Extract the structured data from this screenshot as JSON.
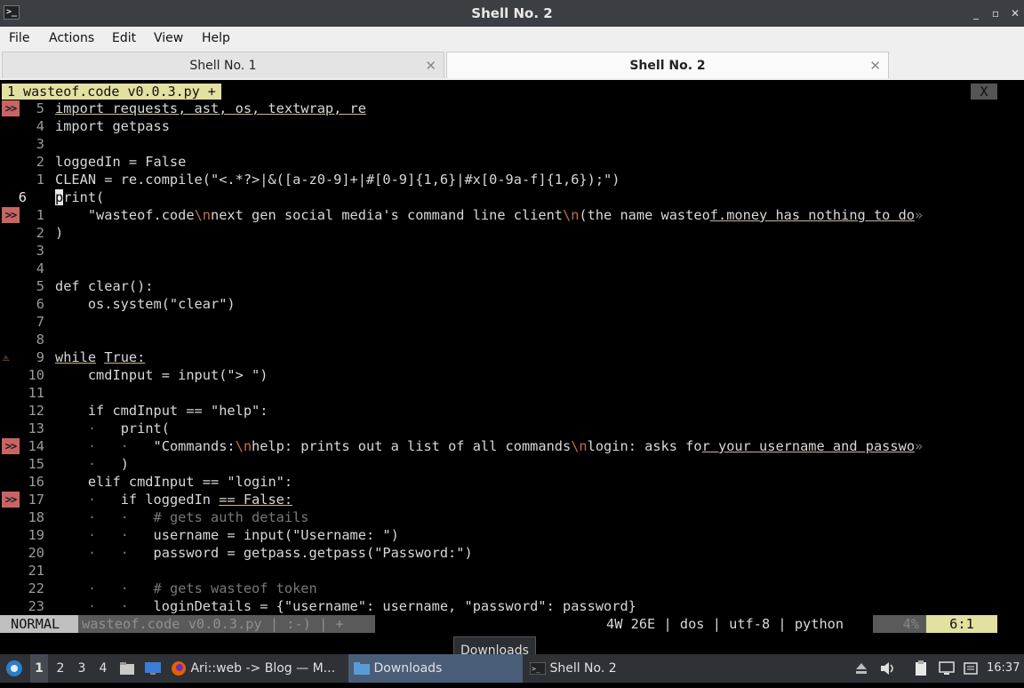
{
  "window": {
    "title": "Shell No. 2"
  },
  "menu": [
    "File",
    "Actions",
    "Edit",
    "View",
    "Help"
  ],
  "tabs": [
    {
      "label": "Shell No. 1"
    },
    {
      "label": "Shell No. 2"
    }
  ],
  "buffer": {
    "tab_label": "1 wasteof.code v0.0.3.py +",
    "close_label": "X"
  },
  "code_lines": [
    {
      "sign": ">>",
      "num": "5",
      "cur": false,
      "segs": [
        {
          "t": "import requests, ast, os, textwrap, re",
          "c": "ul"
        }
      ]
    },
    {
      "sign": "",
      "num": "4",
      "cur": false,
      "segs": [
        {
          "t": "import getpass"
        }
      ]
    },
    {
      "sign": "",
      "num": "3",
      "cur": false,
      "segs": []
    },
    {
      "sign": "",
      "num": "2",
      "cur": false,
      "segs": [
        {
          "t": "loggedIn = False"
        }
      ]
    },
    {
      "sign": "",
      "num": "1",
      "cur": false,
      "segs": [
        {
          "t": "CLEAN = re.compile(\"<.*?>|&([a-z0-9]+|#[0-9]{1,6}|#x[0-9a-f]{1,6});\")"
        }
      ]
    },
    {
      "sign": "",
      "num": "6",
      "cur": true,
      "segs": [
        {
          "t": "p",
          "c": "cursor"
        },
        {
          "t": "rint("
        }
      ]
    },
    {
      "sign": ">>",
      "num": "1",
      "cur": false,
      "segs": [
        {
          "t": "    \"wasteof.code"
        },
        {
          "t": "\\n",
          "c": "esc"
        },
        {
          "t": "next gen social media's command line client"
        },
        {
          "t": "\\n",
          "c": "esc"
        },
        {
          "t": "(the name wasteo"
        },
        {
          "t": "f.money has nothing to do",
          "c": "ul"
        },
        {
          "t": "»",
          "c": "dim"
        }
      ]
    },
    {
      "sign": "",
      "num": "2",
      "cur": false,
      "segs": [
        {
          "t": ")"
        }
      ]
    },
    {
      "sign": "",
      "num": "3",
      "cur": false,
      "segs": []
    },
    {
      "sign": "",
      "num": "4",
      "cur": false,
      "segs": []
    },
    {
      "sign": "",
      "num": "5",
      "cur": false,
      "segs": [
        {
          "t": "def clear():"
        }
      ]
    },
    {
      "sign": "",
      "num": "6",
      "cur": false,
      "segs": [
        {
          "t": "    os.system(\"clear\")"
        }
      ]
    },
    {
      "sign": "",
      "num": "7",
      "cur": false,
      "segs": []
    },
    {
      "sign": "",
      "num": "8",
      "cur": false,
      "segs": []
    },
    {
      "sign": "warn",
      "num": "9",
      "cur": false,
      "segs": [
        {
          "t": "while",
          "c": "ul"
        },
        {
          "t": " "
        },
        {
          "t": "True:",
          "c": "ul"
        }
      ]
    },
    {
      "sign": "",
      "num": "10",
      "cur": false,
      "segs": [
        {
          "t": "    cmdInput = input(\"> \")"
        }
      ]
    },
    {
      "sign": "",
      "num": "11",
      "cur": false,
      "segs": []
    },
    {
      "sign": "",
      "num": "12",
      "cur": false,
      "segs": [
        {
          "t": "    if cmdInput == \"help\":"
        }
      ]
    },
    {
      "sign": "",
      "num": "13",
      "cur": false,
      "segs": [
        {
          "t": "    ·",
          "c": "dim"
        },
        {
          "t": "   print("
        }
      ]
    },
    {
      "sign": ">>",
      "num": "14",
      "cur": false,
      "segs": [
        {
          "t": "    ·   ·",
          "c": "dim"
        },
        {
          "t": "   \"Commands:"
        },
        {
          "t": "\\n",
          "c": "esc"
        },
        {
          "t": "help: prints out a list of all commands"
        },
        {
          "t": "\\n",
          "c": "esc"
        },
        {
          "t": "login: asks fo"
        },
        {
          "t": "r your username and passwo",
          "c": "ul"
        },
        {
          "t": "»",
          "c": "dim"
        }
      ]
    },
    {
      "sign": "",
      "num": "15",
      "cur": false,
      "segs": [
        {
          "t": "    ·",
          "c": "dim"
        },
        {
          "t": "   )"
        }
      ]
    },
    {
      "sign": "",
      "num": "16",
      "cur": false,
      "segs": [
        {
          "t": "    elif cmdInput == \"login\":"
        }
      ]
    },
    {
      "sign": ">>",
      "num": "17",
      "cur": false,
      "segs": [
        {
          "t": "    ·",
          "c": "dim"
        },
        {
          "t": "   if loggedIn "
        },
        {
          "t": "== False:",
          "c": "ul"
        }
      ]
    },
    {
      "sign": "",
      "num": "18",
      "cur": false,
      "segs": [
        {
          "t": "    ·   ·",
          "c": "dim"
        },
        {
          "t": "   # gets auth details",
          "c": "dim"
        }
      ]
    },
    {
      "sign": "",
      "num": "19",
      "cur": false,
      "segs": [
        {
          "t": "    ·   ·",
          "c": "dim"
        },
        {
          "t": "   username = input(\"Username: \")"
        }
      ]
    },
    {
      "sign": "",
      "num": "20",
      "cur": false,
      "segs": [
        {
          "t": "    ·   ·",
          "c": "dim"
        },
        {
          "t": "   password = getpass.getpass(\"Password:\")"
        }
      ]
    },
    {
      "sign": "",
      "num": "21",
      "cur": false,
      "segs": []
    },
    {
      "sign": "",
      "num": "22",
      "cur": false,
      "segs": [
        {
          "t": "    ·   ·",
          "c": "dim"
        },
        {
          "t": "   # gets wasteof token",
          "c": "dim"
        }
      ]
    },
    {
      "sign": "",
      "num": "23",
      "cur": false,
      "segs": [
        {
          "t": "    ·   ·",
          "c": "dim"
        },
        {
          "t": "   loginDetails = {\"username\": username, \"password\": password}"
        }
      ]
    }
  ],
  "statusline": {
    "mode": "NORMAL",
    "file": "wasteof.code v0.0.3.py | :-) | +",
    "info": "4W 26E | dos | utf-8 | python",
    "percent": "4%",
    "position": "6:1"
  },
  "taskbar": {
    "workspaces": [
      "1",
      "2",
      "3",
      "4"
    ],
    "tasks": [
      "Ari::web -> Blog — M...",
      "Downloads",
      "Shell No. 2"
    ],
    "tooltip": "Downloads",
    "clock": "16:37"
  }
}
